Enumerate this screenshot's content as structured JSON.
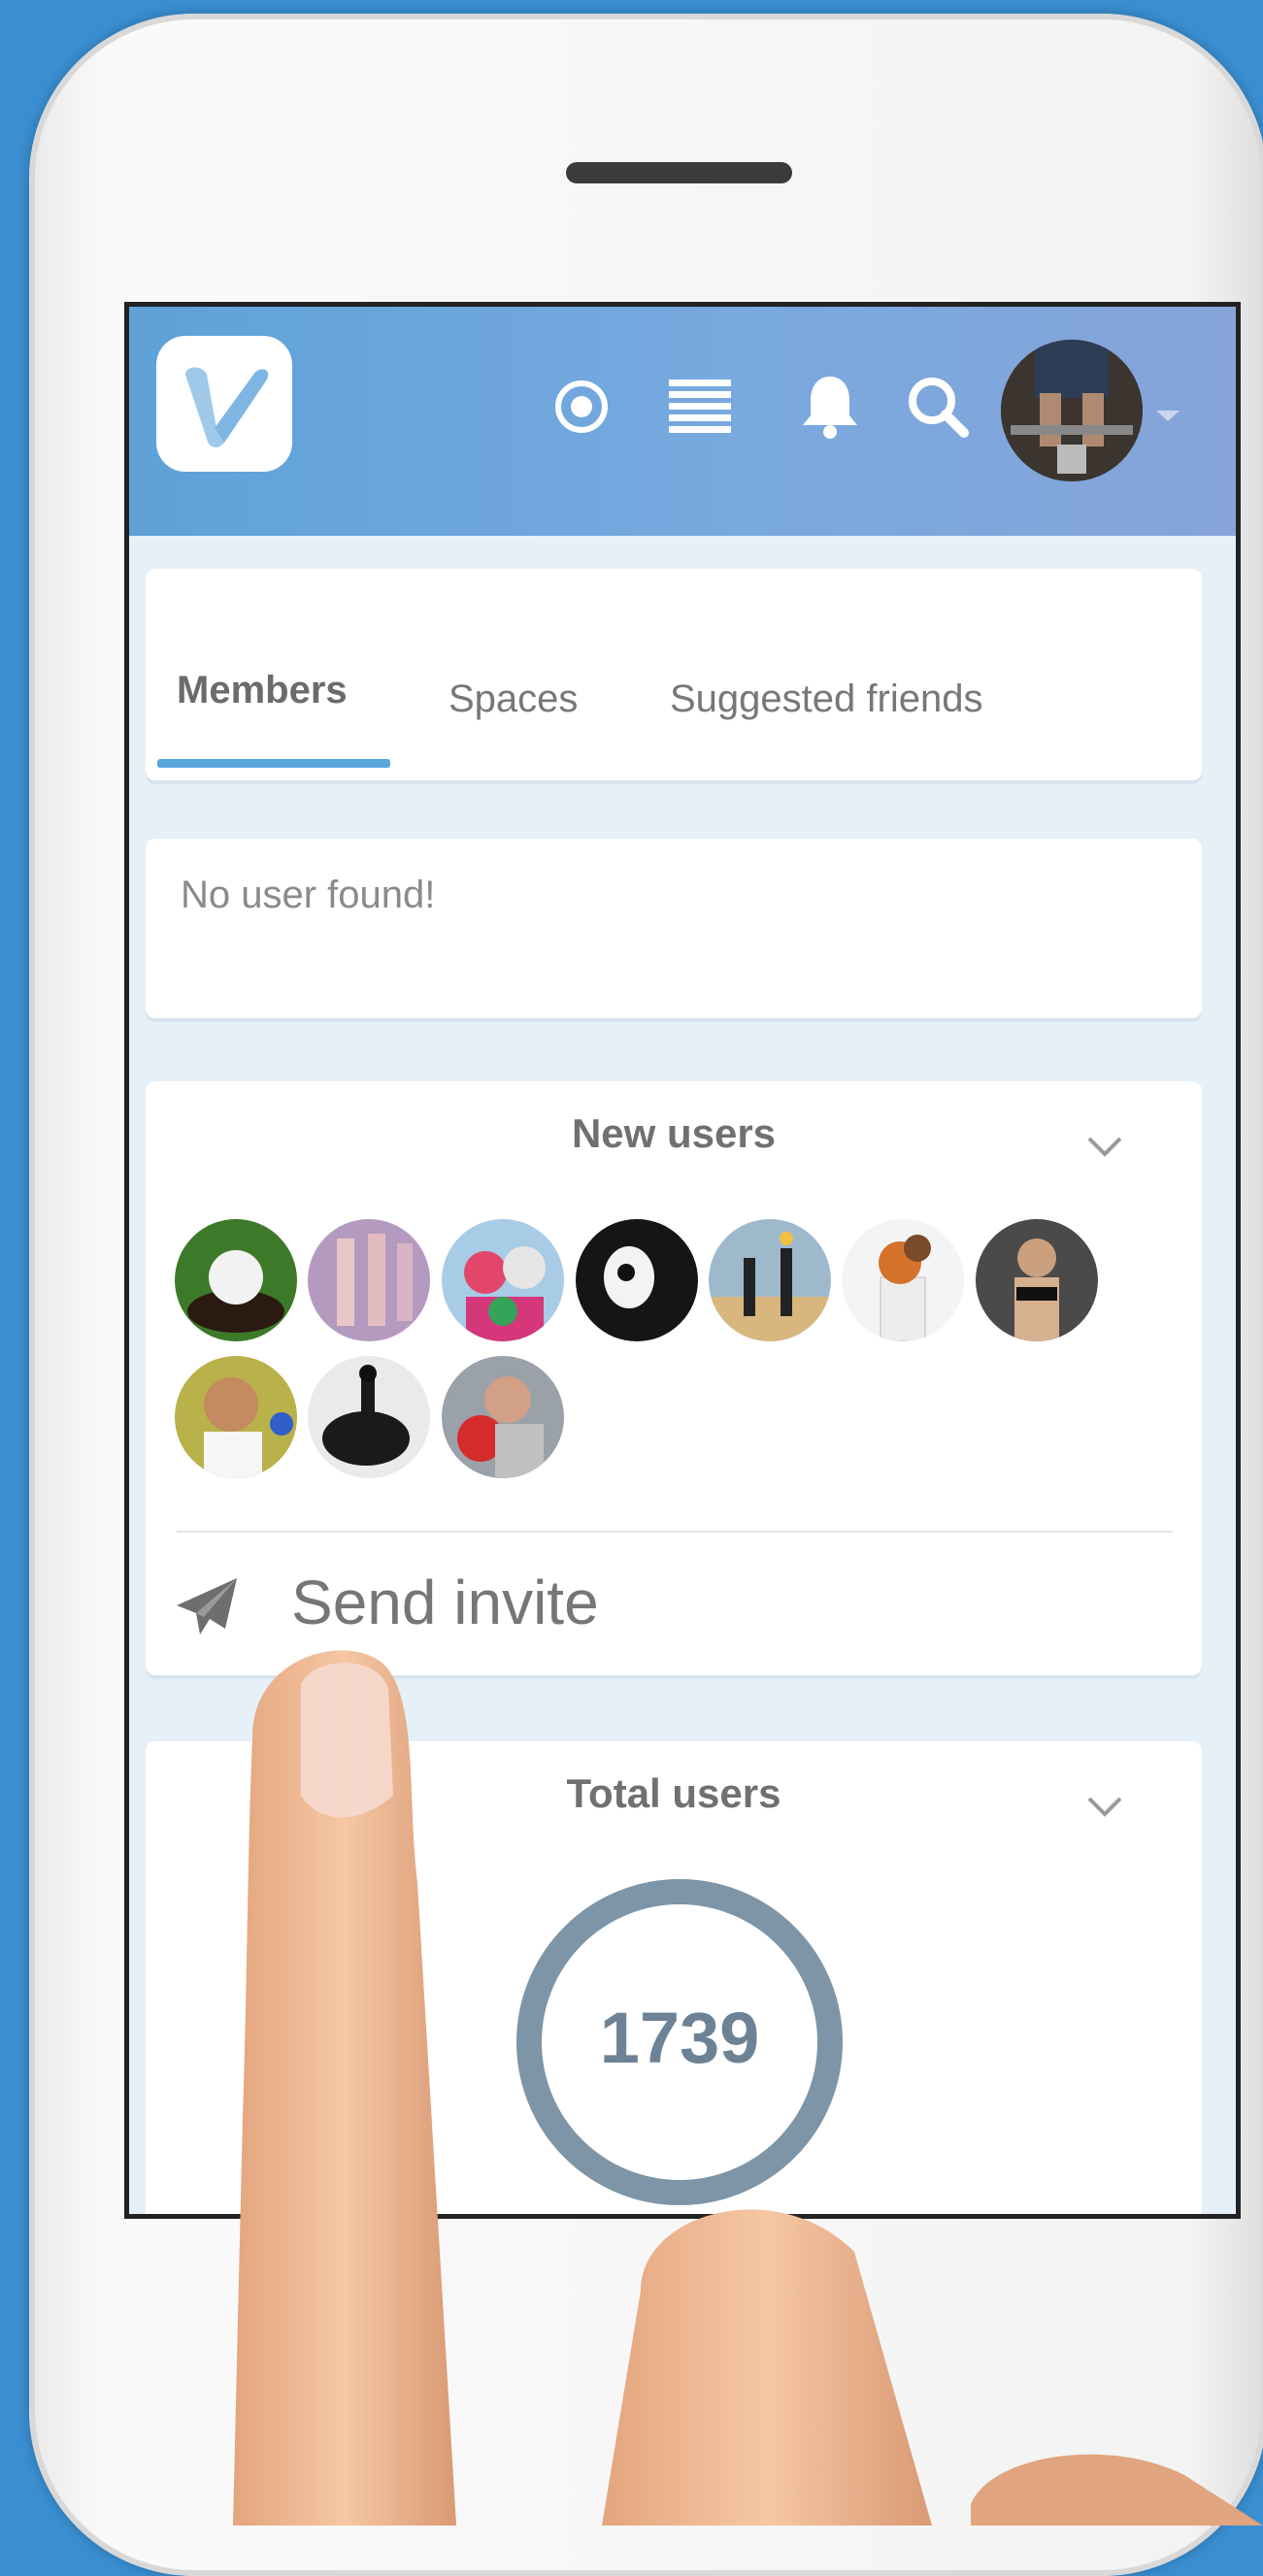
{
  "tabs": {
    "members": "Members",
    "spaces": "Spaces",
    "suggested": "Suggested friends"
  },
  "search_result": {
    "message": "No user found!"
  },
  "new_users": {
    "title": "New users",
    "avatars": [
      "golf ball",
      "ballet dancers",
      "kids skiing",
      "panda mascot",
      "beach volleyball",
      "basketball player",
      "fitness woman",
      "smiling woman",
      "dressage rider",
      "boxer"
    ]
  },
  "invite": {
    "label": "Send invite"
  },
  "total_users": {
    "title": "Total users",
    "count": "1739"
  },
  "colors": {
    "header": "#6fa6dc",
    "accent": "#5aa5da",
    "ring": "#7d95a6"
  }
}
